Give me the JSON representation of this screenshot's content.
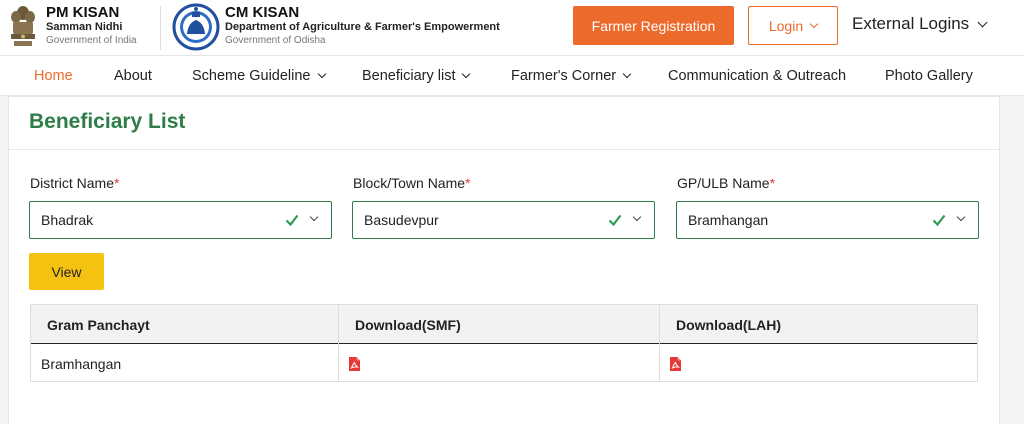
{
  "header": {
    "pm_kisan": {
      "title": "PM KISAN",
      "subtitle": "Samman Nidhi",
      "gov": "Government of India"
    },
    "cm_kisan": {
      "title": "CM KISAN",
      "subtitle": "Department of Agriculture & Farmer's Empowerment",
      "gov": "Government of Odisha"
    },
    "register_label": "Farmer Registration",
    "login_label": "Login",
    "external_logins_label": "External Logins"
  },
  "nav": {
    "items": [
      {
        "label": "Home",
        "active": true,
        "has_dropdown": false
      },
      {
        "label": "About",
        "active": false,
        "has_dropdown": false
      },
      {
        "label": "Scheme Guideline",
        "active": false,
        "has_dropdown": true
      },
      {
        "label": "Beneficiary list",
        "active": false,
        "has_dropdown": true
      },
      {
        "label": "Farmer's Corner",
        "active": false,
        "has_dropdown": true
      },
      {
        "label": "Communication & Outreach",
        "active": false,
        "has_dropdown": false
      },
      {
        "label": "Photo Gallery",
        "active": false,
        "has_dropdown": false
      }
    ]
  },
  "main": {
    "title": "Beneficiary List",
    "fields": [
      {
        "label": "District Name",
        "required_mark": "*",
        "value": "Bhadrak"
      },
      {
        "label": "Block/Town Name",
        "required_mark": "*",
        "value": "Basudevpur"
      },
      {
        "label": "GP/ULB Name",
        "required_mark": "*",
        "value": "Bramhangan"
      }
    ],
    "view_label": "View",
    "table": {
      "headers": [
        "Gram Panchayt",
        "Download(SMF)",
        "Download(LAH)"
      ],
      "rows": [
        {
          "gram_panchayat": "Bramhangan",
          "smf_icon": "pdf-icon",
          "lah_icon": "pdf-icon"
        }
      ]
    }
  },
  "colors": {
    "accent_orange": "#ec6a2b",
    "title_green": "#2e7d48",
    "view_yellow": "#f5c211",
    "pdf_red": "#e53935"
  }
}
